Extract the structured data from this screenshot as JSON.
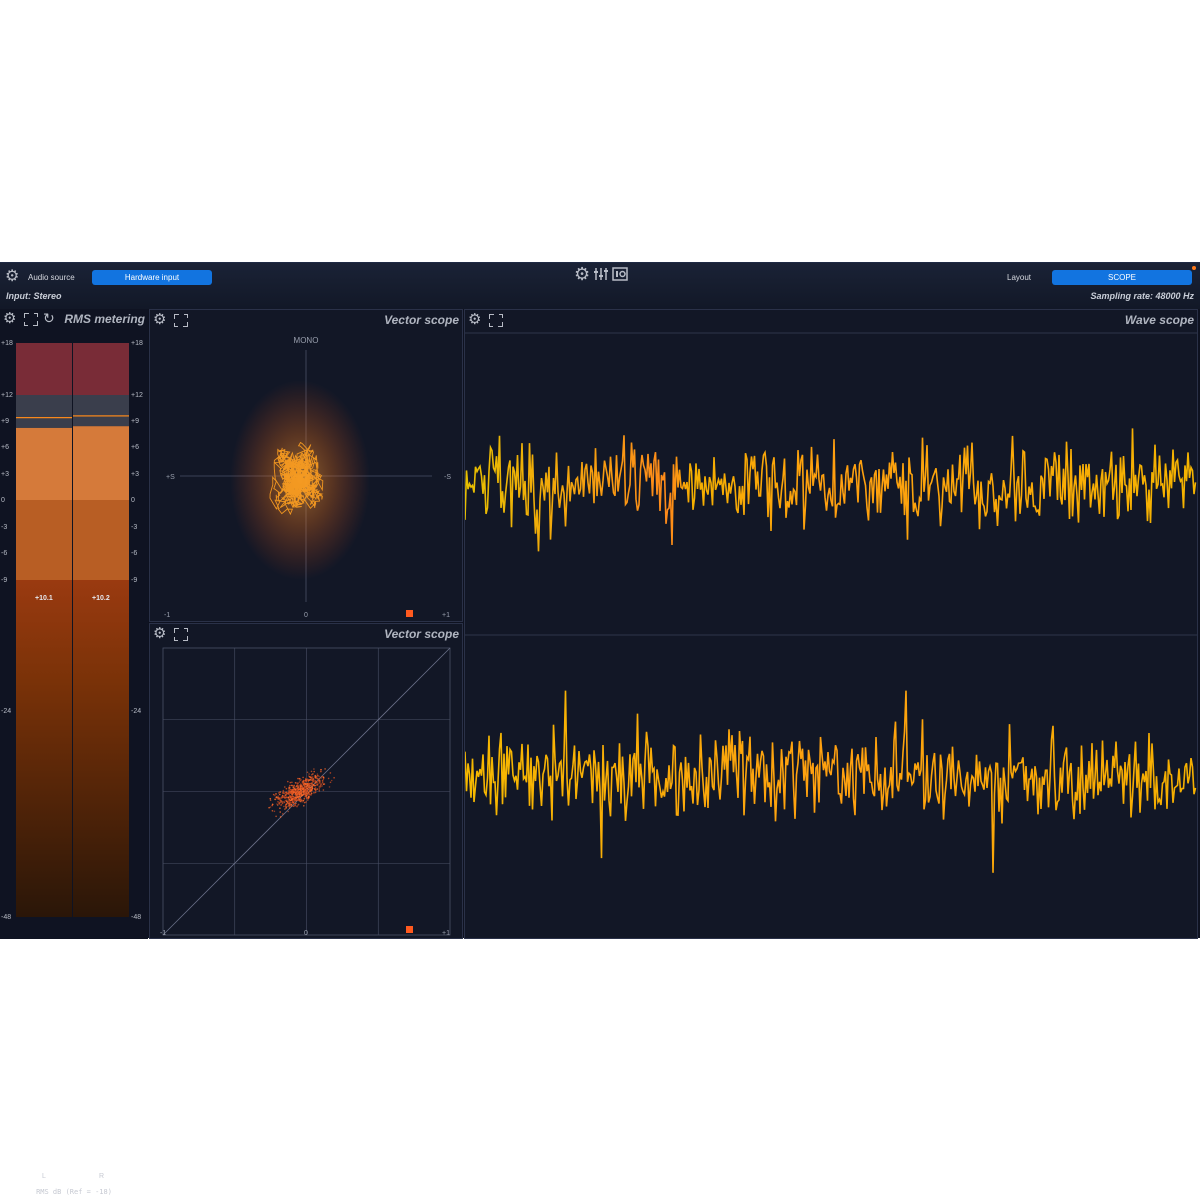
{
  "topbar": {
    "audio_source_label": "Audio source",
    "source_button": "Hardware input",
    "input_label": "Input: Stereo",
    "layout_label": "Layout",
    "layout_button": "SCOPE",
    "sampling_rate": "Sampling rate: 48000 Hz"
  },
  "rms": {
    "title": "RMS metering",
    "peak_left": "+10.1",
    "peak_right": "+10.2",
    "scale_left": [
      "+18",
      "+12",
      "+9",
      "+6",
      "+3",
      "0",
      "-3",
      "-6",
      "-9",
      "-24",
      "-48"
    ],
    "scale_right": [
      "+18",
      "+12",
      "+9",
      "+6",
      "+3",
      "0",
      "-3",
      "-6",
      "-9",
      "-24",
      "-48"
    ],
    "channel_left": "L",
    "channel_right": "R",
    "footer": "RMS dB (Ref = -18)",
    "level_left_db": 8.2,
    "level_right_db": 8.4
  },
  "vector_top": {
    "title": "Vector scope",
    "mono_label": "MONO",
    "left_axis": "+S",
    "right_axis": "-S",
    "x_min": "-1",
    "x_mid": "0",
    "x_max": "+1"
  },
  "vector_bottom": {
    "title": "Vector scope",
    "x_min": "-1",
    "x_mid": "0",
    "x_max": "+1"
  },
  "wave": {
    "title": "Wave scope"
  },
  "colors": {
    "accent": "#1274e0",
    "wave_yellow": "#f5b800",
    "wave_orange": "#ff8c1a",
    "marker": "#ff5a1f"
  },
  "icons": [
    "gear-icon",
    "mixer-icon",
    "io-icon",
    "fullscreen-icon",
    "reset-icon"
  ]
}
